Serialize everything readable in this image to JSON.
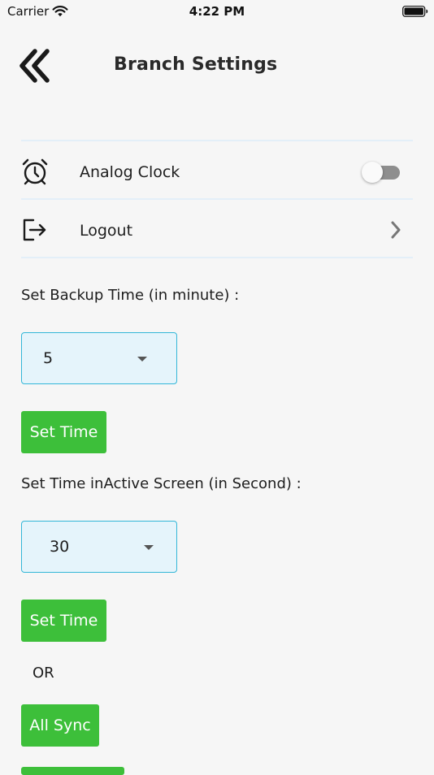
{
  "status_bar": {
    "carrier": "Carrier",
    "time": "4:22 PM",
    "icons": [
      "wifi-icon",
      "battery-icon"
    ]
  },
  "header": {
    "title": "Branch Settings",
    "back_icon": "double-chevron-left-icon"
  },
  "settings": {
    "analog_clock": {
      "label": "Analog Clock",
      "icon": "alarm-clock-icon",
      "enabled": false
    },
    "logout": {
      "label": "Logout",
      "icon": "logout-icon",
      "trailing_icon": "chevron-right-icon"
    }
  },
  "backup_time": {
    "label": "Set Backup Time (in minute) :",
    "selected": "5",
    "button_label": "Set Time"
  },
  "inactive_screen": {
    "label": "Set Time inActive Screen (in Second) :",
    "selected": "30",
    "button_label": "Set Time"
  },
  "or_text": "OR",
  "all_sync_label": "All Sync",
  "colors": {
    "background": "#f6f6f6",
    "button_green": "#3dbf3a",
    "dropdown_fill": "#e5f4fb",
    "dropdown_border": "#33b7d8",
    "divider": "#e3eff8",
    "toggle_off": "#8e8e8e"
  }
}
